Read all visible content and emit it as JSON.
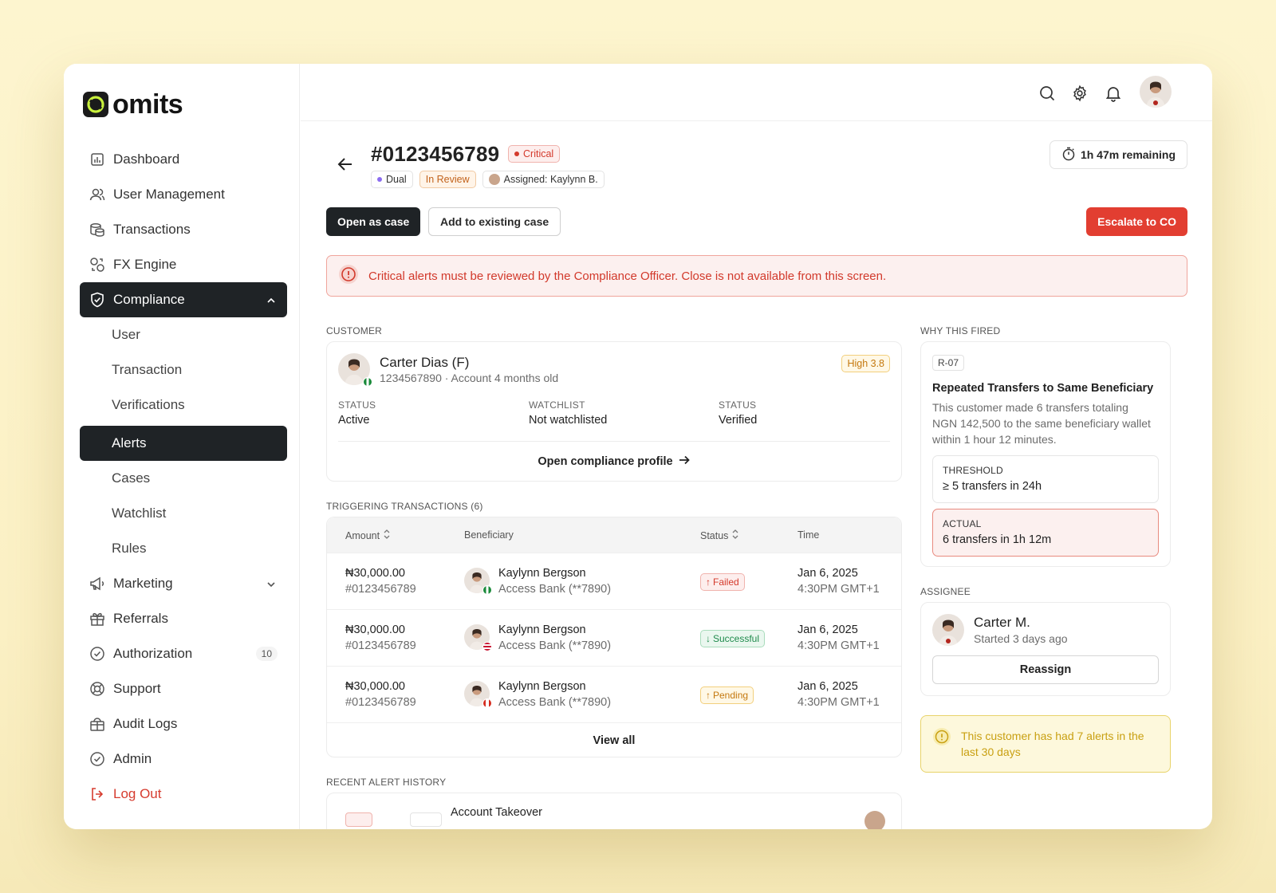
{
  "brand": {
    "name": "omits"
  },
  "sidebar": {
    "items": [
      {
        "label": "Dashboard"
      },
      {
        "label": "User Management"
      },
      {
        "label": "Transactions"
      },
      {
        "label": "FX Engine"
      },
      {
        "label": "Compliance"
      },
      {
        "label": "User"
      },
      {
        "label": "Transaction"
      },
      {
        "label": "Verifications"
      },
      {
        "label": "Alerts"
      },
      {
        "label": "Cases"
      },
      {
        "label": "Watchlist"
      },
      {
        "label": "Rules"
      },
      {
        "label": "Marketing"
      },
      {
        "label": "Referrals"
      },
      {
        "label": "Authorization",
        "count": "10"
      },
      {
        "label": "Support"
      },
      {
        "label": "Audit Logs"
      },
      {
        "label": "Admin"
      },
      {
        "label": "Log Out"
      }
    ]
  },
  "header": {
    "alert_id": "#0123456789",
    "severity": "Critical",
    "tags": {
      "type": "Dual",
      "state": "In Review",
      "assigned": "Assigned: Kaylynn B."
    },
    "timer": "1h 47m remaining"
  },
  "actions": {
    "open_case": "Open as case",
    "add_case": "Add to existing case",
    "escalate": "Escalate to CO"
  },
  "banner": "Critical alerts must be reviewed by the Compliance Officer. Close is not available from this screen.",
  "customer": {
    "section": "CUSTOMER",
    "name": "Carter Dias (F)",
    "sub": "1234567890 · Account 4 months old",
    "risk": "High 3.8",
    "stats": [
      {
        "k": "STATUS",
        "v": "Active"
      },
      {
        "k": "WATCHLIST",
        "v": "Not watchlisted"
      },
      {
        "k": "STATUS",
        "v": "Verified"
      }
    ],
    "profile_link": "Open compliance profile"
  },
  "transactions": {
    "section": "TRIGGERING TRANSACTIONS (6)",
    "headers": {
      "amount": "Amount",
      "beneficiary": "Beneficiary",
      "status": "Status",
      "time": "Time"
    },
    "rows": [
      {
        "amount": "₦30,000.00",
        "id": "#0123456789",
        "name": "Kaylynn Bergson",
        "bank": "Access Bank (**7890)",
        "status": "Failed",
        "date": "Jan 6, 2025",
        "time": "4:30PM GMT+1"
      },
      {
        "amount": "₦30,000.00",
        "id": "#0123456789",
        "name": "Kaylynn Bergson",
        "bank": "Access Bank (**7890)",
        "status": "Successful",
        "date": "Jan 6, 2025",
        "time": "4:30PM GMT+1"
      },
      {
        "amount": "₦30,000.00",
        "id": "#0123456789",
        "name": "Kaylynn Bergson",
        "bank": "Access Bank (**7890)",
        "status": "Pending",
        "date": "Jan 6, 2025",
        "time": "4:30PM GMT+1"
      }
    ],
    "view_all": "View all"
  },
  "history": {
    "section": "RECENT ALERT HISTORY",
    "first_title": "Account Takeover"
  },
  "why": {
    "section": "WHY THIS FIRED",
    "rule_id": "R-07",
    "title": "Repeated Transfers to Same Beneficiary",
    "desc": "This customer made 6 transfers totaling NGN 142,500 to the same beneficiary wallet within 1 hour 12 minutes.",
    "threshold_label": "THRESHOLD",
    "threshold_value": "≥ 5 transfers in 24h",
    "actual_label": "ACTUAL",
    "actual_value": "6 transfers in 1h 12m"
  },
  "assignee": {
    "section": "ASSIGNEE",
    "name": "Carter M.",
    "sub": "Started 3 days ago",
    "button": "Reassign"
  },
  "notice": "This customer has had 7 alerts in the last 30 days"
}
